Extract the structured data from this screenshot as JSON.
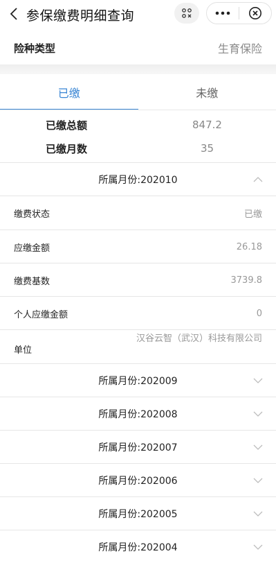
{
  "nav": {
    "title": "参保缴费明细查询"
  },
  "insurance": {
    "label": "险种类型",
    "value": "生育保险"
  },
  "tabs": [
    {
      "label": "已缴",
      "active": true
    },
    {
      "label": "未缴",
      "active": false
    }
  ],
  "summary": {
    "total_label": "已缴总额",
    "total_value": "847.2",
    "months_label": "已缴月数",
    "months_value": "35"
  },
  "expanded": {
    "month_label": "所属月份:202010",
    "rows": [
      {
        "label": "缴费状态",
        "value": "已缴"
      },
      {
        "label": "应缴金额",
        "value": "26.18"
      },
      {
        "label": "缴费基数",
        "value": "3739.8"
      },
      {
        "label": "个人应缴金额",
        "value": "0"
      }
    ],
    "unit_label": "单位",
    "unit_value": "汉谷云智（武汉）科技有限公司"
  },
  "collapsed_months": [
    "所属月份:202009",
    "所属月份:202008",
    "所属月份:202007",
    "所属月份:202006",
    "所属月份:202005",
    "所属月份:202004"
  ],
  "colors": {
    "accent": "#3a86d4",
    "muted": "#999999"
  },
  "icons": {
    "back": "chevron-left-icon",
    "scan": "scan-icon",
    "more": "more-dots-icon",
    "close": "close-circle-icon",
    "expand_up": "chevron-up-icon",
    "expand_down": "chevron-down-icon"
  }
}
